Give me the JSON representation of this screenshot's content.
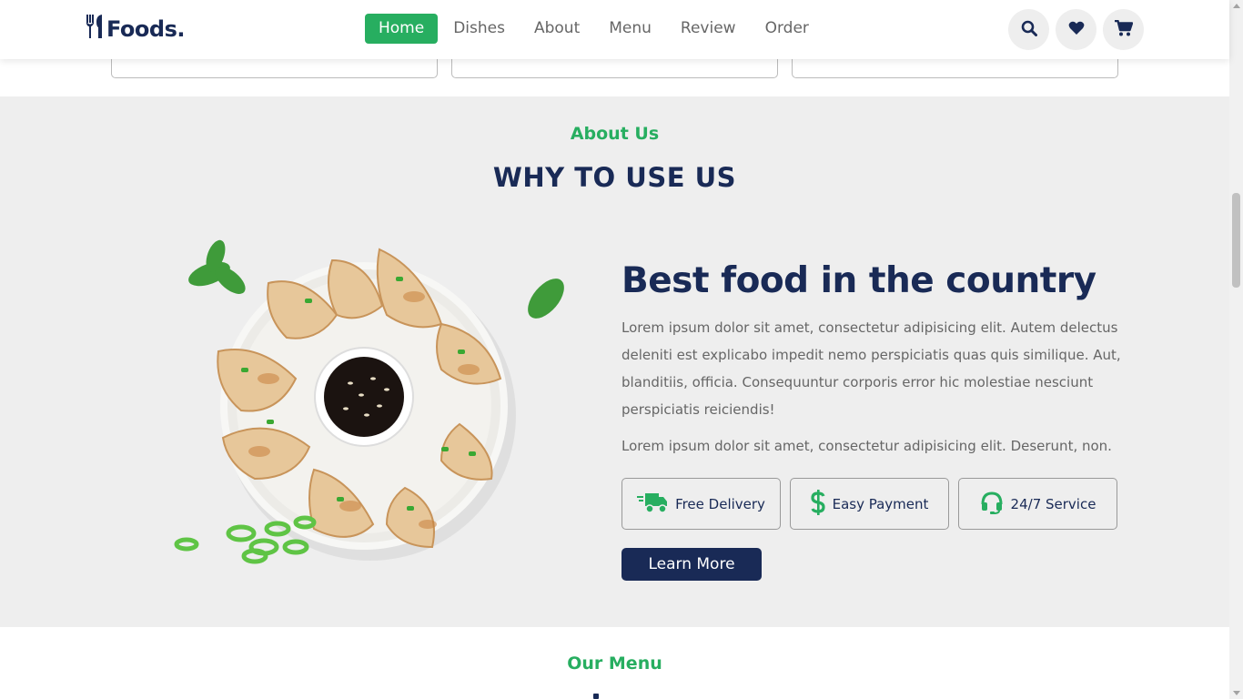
{
  "brand": {
    "logo_text": "Foods.",
    "logo_icon": "utensils-icon"
  },
  "nav": {
    "items": [
      {
        "label": "Home",
        "active": true
      },
      {
        "label": "Dishes",
        "active": false
      },
      {
        "label": "About",
        "active": false
      },
      {
        "label": "Menu",
        "active": false
      },
      {
        "label": "Review",
        "active": false
      },
      {
        "label": "Order",
        "active": false
      }
    ]
  },
  "header_icons": [
    "search-icon",
    "heart-icon",
    "cart-icon"
  ],
  "about": {
    "subheading": "About Us",
    "heading": "WHY TO USE US",
    "image_icon": "dumplings-plate-image",
    "title": "Best food in the country",
    "paragraph1": "Lorem ipsum dolor sit amet, consectetur adipisicing elit. Autem delectus deleniti est explicabo impedit nemo perspiciatis quas quis similique. Aut, blanditiis, officia. Consequuntur corporis error hic molestiae nesciunt perspiciatis reiciendis!",
    "paragraph2": "Lorem ipsum dolor sit amet, consectetur adipisicing elit. Deserunt, non.",
    "features": [
      {
        "label": "Free Delivery",
        "icon": "shipping-fast-icon"
      },
      {
        "label": "Easy Payment",
        "icon": "dollar-sign-icon"
      },
      {
        "label": "24/7 Service",
        "icon": "headset-icon"
      }
    ],
    "button_label": "Learn More"
  },
  "menu_section": {
    "subheading": "Our Menu"
  },
  "colors": {
    "green": "#27ae60",
    "navy": "#192a56",
    "section_bg": "#eeeeee"
  }
}
